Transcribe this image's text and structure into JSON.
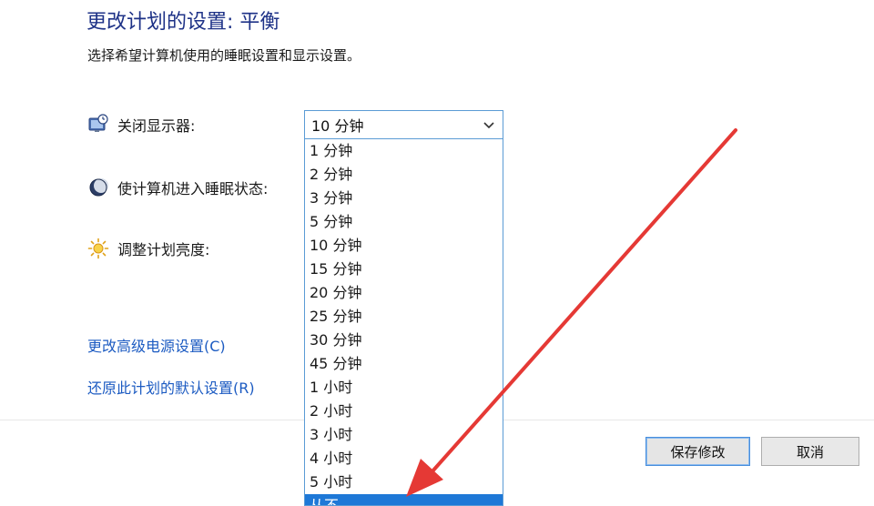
{
  "header": {
    "title": "更改计划的设置: 平衡",
    "subtitle": "选择希望计算机使用的睡眠设置和显示设置。"
  },
  "settings": {
    "display_off_label": "关闭显示器:",
    "sleep_label": "使计算机进入睡眠状态:",
    "brightness_label": "调整计划亮度:"
  },
  "display_select": {
    "value": "10 分钟",
    "options": [
      "1 分钟",
      "2 分钟",
      "3 分钟",
      "5 分钟",
      "10 分钟",
      "15 分钟",
      "20 分钟",
      "25 分钟",
      "30 分钟",
      "45 分钟",
      "1 小时",
      "2 小时",
      "3 小时",
      "4 小时",
      "5 小时",
      "从不"
    ]
  },
  "links": {
    "advanced": "更改高级电源设置(C)",
    "restore": "还原此计划的默认设置(R)"
  },
  "buttons": {
    "save": "保存修改",
    "cancel": "取消"
  },
  "colors": {
    "title": "#1e3287",
    "link": "#1c5bc2",
    "select_border": "#5b9bd5",
    "highlight": "#1e78d7",
    "annotation_arrow": "#e53935"
  },
  "icons": {
    "display": "monitor-clock-icon",
    "sleep": "moon-icon",
    "brightness": "sun-icon",
    "dropdown": "chevron-down-icon"
  }
}
